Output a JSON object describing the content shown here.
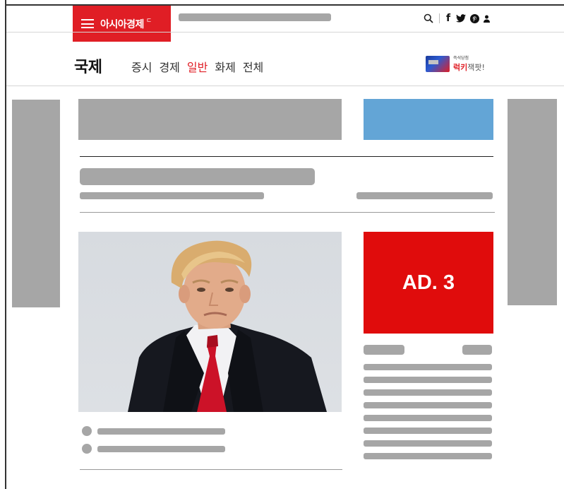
{
  "header": {
    "logo_text": "아시아경제",
    "logo_mark": "ㄷ",
    "icons": [
      "menu-icon",
      "search-icon",
      "facebook-icon",
      "twitter-icon",
      "pinterest-icon",
      "user-icon"
    ]
  },
  "section": {
    "title": "국제",
    "nav": [
      {
        "label": "증시",
        "active": false
      },
      {
        "label": "경제",
        "active": false
      },
      {
        "label": "일반",
        "active": true
      },
      {
        "label": "화제",
        "active": false
      },
      {
        "label": "전체",
        "active": false
      }
    ],
    "promo_small": "즉석당첨",
    "promo_red": "럭키",
    "promo_gray": "잭팟!"
  },
  "ads": {
    "ad3_label": "AD. 3"
  },
  "colors": {
    "brand_red": "#e01e25",
    "ad_red": "#e00c0c",
    "ad_blue": "#63a5d6",
    "placeholder": "#a6a6a6"
  }
}
